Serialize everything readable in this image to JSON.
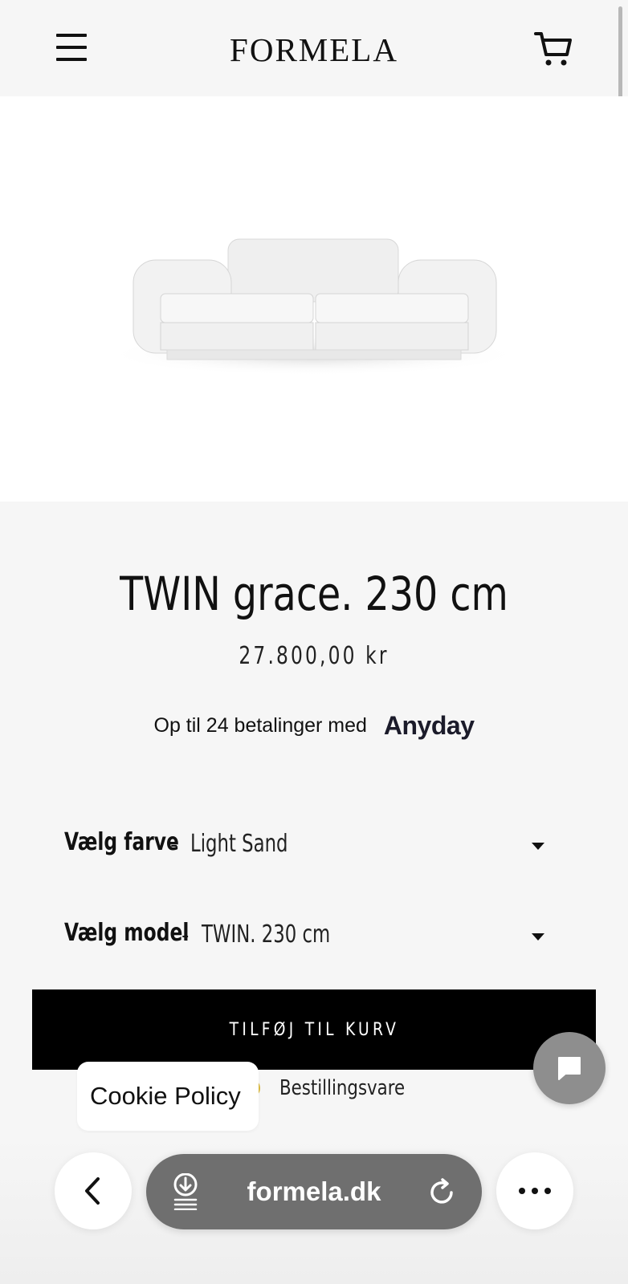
{
  "header": {
    "logo": "FORMELA",
    "menu_icon": "hamburger-menu-icon",
    "cart_icon": "shopping-cart-icon"
  },
  "hero": {
    "image": "white-two-seat-sofa-product-photo"
  },
  "product": {
    "title": "TWIN grace. 230 cm",
    "price": "27.800,00 kr",
    "financing_text": "Op til 24 betalinger med",
    "financing_brand": "Anyday"
  },
  "options": {
    "color_label": "Vælg farve",
    "color_value": "Light Sand",
    "model_label": "Vælg model",
    "model_value": "TWIN. 230 cm",
    "separator": "-"
  },
  "cta": {
    "add_to_cart": "TILFØJ TIL KURV"
  },
  "stock": {
    "status": "Bestillingsvare",
    "status_color": "#d9b83a"
  },
  "cookie": {
    "label": "Cookie Policy"
  },
  "browser": {
    "url": "formela.dk",
    "back_icon": "chevron-left-icon",
    "download_icon": "download-icon",
    "reload_icon": "reload-icon",
    "more_icon": "more-dots-icon"
  }
}
